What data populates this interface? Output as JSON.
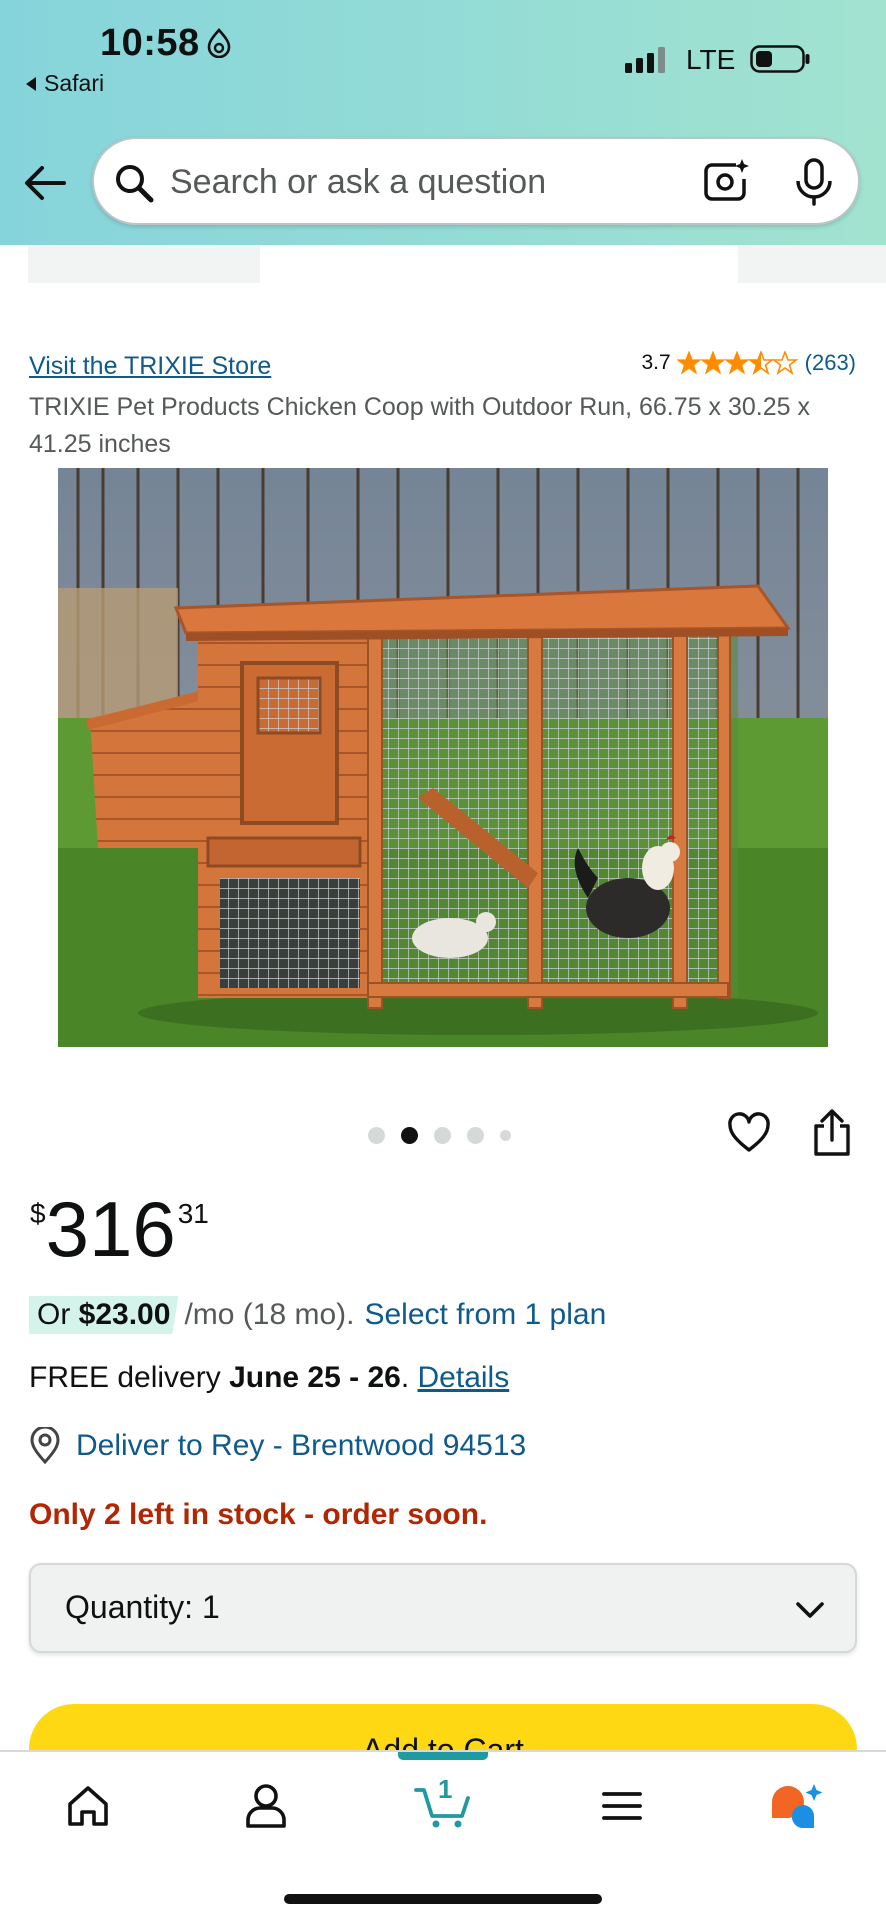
{
  "status_bar": {
    "time": "10:58",
    "back_app": "Safari",
    "network": "LTE"
  },
  "search": {
    "placeholder": "Search or ask a question"
  },
  "product": {
    "store_link": "Visit the TRIXIE Store",
    "rating": "3.7",
    "rating_stars": 3.7,
    "review_count": "(263)",
    "title": "TRIXIE Pet Products Chicken Coop with Outdoor Run, 66.75 x 30.25 x 41.25 inches",
    "image_count": 5,
    "current_image": 2
  },
  "price": {
    "symbol": "$",
    "whole": "316",
    "fraction": "31"
  },
  "monthly": {
    "prefix": "Or",
    "amount": "$23.00",
    "suffix": "/mo (18 mo).",
    "plan_link": "Select from 1 plan"
  },
  "delivery": {
    "prefix": "FREE delivery",
    "dates": "June 25 - 26",
    "period": ".",
    "details_link": "Details"
  },
  "deliver_to": "Deliver to Rey - Brentwood 94513",
  "stock": "Only 2 left in stock - order soon.",
  "quantity": {
    "label": "Quantity:",
    "value": "1"
  },
  "add_to_cart": "Add to Cart",
  "bottom_nav": {
    "cart_count": "1"
  },
  "colors": {
    "link": "#0f5a8c",
    "stock_warning": "#b12704",
    "star": "#ff8c00",
    "cart_button": "#ffd814",
    "accent_teal": "#1e9aa0"
  }
}
